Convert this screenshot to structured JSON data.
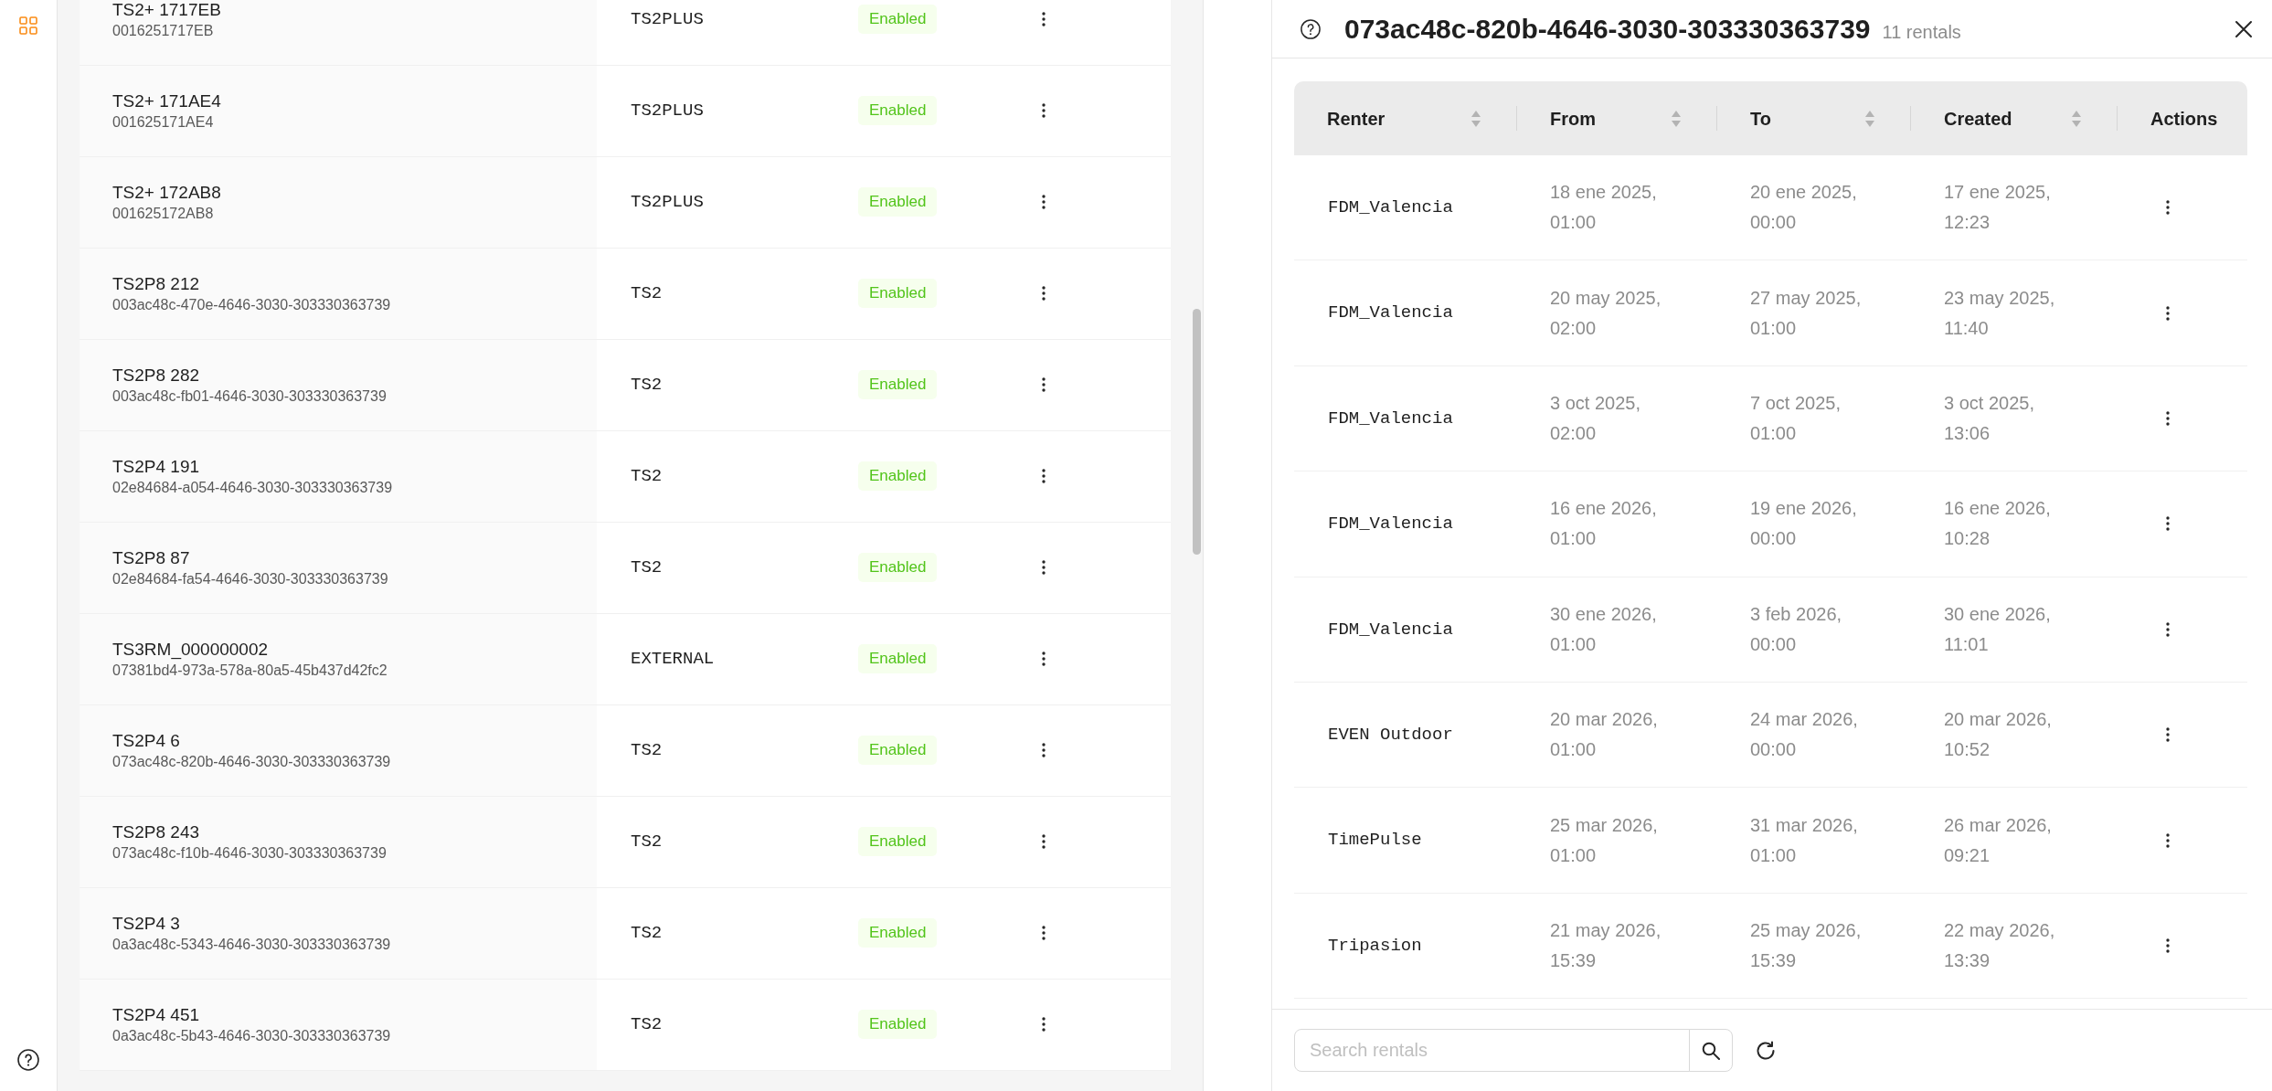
{
  "sidebar": {
    "items": [
      {
        "selected": true
      }
    ]
  },
  "devices": {
    "rows": [
      {
        "name": "TS2+ 1717EB",
        "serial": "0016251717EB",
        "type": "TS2PLUS",
        "status": "Enabled",
        "enabled": true
      },
      {
        "name": "TS2+ 171AE4",
        "serial": "001625171AE4",
        "type": "TS2PLUS",
        "status": "Enabled",
        "enabled": true
      },
      {
        "name": "TS2+ 172AB8",
        "serial": "001625172AB8",
        "type": "TS2PLUS",
        "status": "Enabled",
        "enabled": true
      },
      {
        "name": "TS2P8 212",
        "serial": "003ac48c-470e-4646-3030-303330363739",
        "type": "TS2",
        "status": "Enabled",
        "enabled": true
      },
      {
        "name": "TS2P8 282",
        "serial": "003ac48c-fb01-4646-3030-303330363739",
        "type": "TS2",
        "status": "Enabled",
        "enabled": true
      },
      {
        "name": "TS2P4 191",
        "serial": "02e84684-a054-4646-3030-303330363739",
        "type": "TS2",
        "status": "Enabled",
        "enabled": true
      },
      {
        "name": "TS2P8 87",
        "serial": "02e84684-fa54-4646-3030-303330363739",
        "type": "TS2",
        "status": "Enabled",
        "enabled": true
      },
      {
        "name": "TS3RM_000000002",
        "serial": "07381bd4-973a-578a-80a5-45b437d42fc2",
        "type": "EXTERNAL",
        "status": "Enabled",
        "enabled": true
      },
      {
        "name": "TS2P4 6",
        "serial": "073ac48c-820b-4646-3030-303330363739",
        "type": "TS2",
        "status": "Enabled",
        "enabled": true
      },
      {
        "name": "TS2P8 243",
        "serial": "073ac48c-f10b-4646-3030-303330363739",
        "type": "TS2",
        "status": "Enabled",
        "enabled": true
      },
      {
        "name": "TS2P4 3",
        "serial": "0a3ac48c-5343-4646-3030-303330363739",
        "type": "TS2",
        "status": "Enabled",
        "enabled": true
      },
      {
        "name": "TS2P4 451",
        "serial": "0a3ac48c-5b43-4646-3030-303330363739",
        "type": "TS2",
        "status": "Enabled",
        "enabled": true
      }
    ]
  },
  "rentals_drawer": {
    "title": "073ac48c-820b-4646-3030-303330363739",
    "count": "11 rentals",
    "table": {
      "columns": [
        {
          "label": "Renter",
          "sortable": true
        },
        {
          "label": "From",
          "sortable": true
        },
        {
          "label": "To",
          "sortable": true
        },
        {
          "label": "Created",
          "sortable": true
        },
        {
          "label": "Actions",
          "sortable": false
        }
      ],
      "rows": [
        {
          "renter": "FDM_Valencia",
          "from": "18 ene 2025, 01:00",
          "to": "20 ene 2025, 00:00",
          "created": "17 ene 2025, 12:23"
        },
        {
          "renter": "FDM_Valencia",
          "from": "20 may 2025, 02:00",
          "to": "27 may 2025, 01:00",
          "created": "23 may 2025, 11:40"
        },
        {
          "renter": "FDM_Valencia",
          "from": "3 oct 2025, 02:00",
          "to": "7 oct 2025, 01:00",
          "created": "3 oct 2025, 13:06"
        },
        {
          "renter": "FDM_Valencia",
          "from": "16 ene 2026, 01:00",
          "to": "19 ene 2026, 00:00",
          "created": "16 ene 2026, 10:28"
        },
        {
          "renter": "FDM_Valencia",
          "from": "30 ene 2026, 01:00",
          "to": "3 feb 2026, 00:00",
          "created": "30 ene 2026, 11:01"
        },
        {
          "renter": "EVEN Outdoor",
          "from": "20 mar 2026, 01:00",
          "to": "24 mar 2026, 00:00",
          "created": "20 mar 2026, 10:52"
        },
        {
          "renter": "TimePulse",
          "from": "25 mar 2026, 01:00",
          "to": "31 mar 2026, 01:00",
          "created": "26 mar 2026, 09:21"
        },
        {
          "renter": "Tripasion",
          "from": "21 may 2026, 15:39",
          "to": "25 may 2026, 15:39",
          "created": "22 may 2026, 13:39"
        }
      ]
    },
    "search": {
      "placeholder": "Search rentals"
    }
  }
}
